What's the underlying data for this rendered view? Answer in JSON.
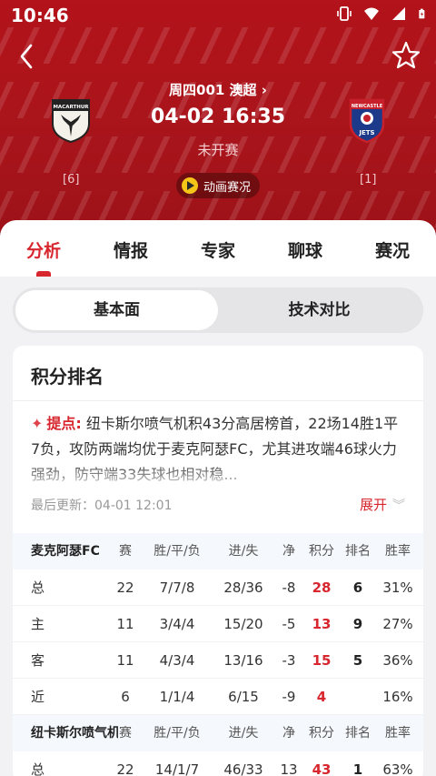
{
  "status_bar": {
    "time": "10:46"
  },
  "header": {
    "league": "周四001  澳超",
    "kickoff": "04-02 16:35",
    "match_status": "未开赛",
    "home": {
      "logo_text": "MACARTHUR",
      "rank": "[6]"
    },
    "away": {
      "logo_text": "NEWCASTLE",
      "logo_sub": "JETS",
      "rank": "[1]"
    },
    "animation_label": "动画赛况"
  },
  "tabs": [
    "分析",
    "情报",
    "专家",
    "聊球",
    "赛况"
  ],
  "segment": [
    "基本面",
    "技术对比"
  ],
  "standings": {
    "title": "积分排名",
    "tip_label": "提点:",
    "tip_text": "纽卡斯尔喷气机积43分高居榜首，22场14胜1平7负，攻防两端均优于麦克阿瑟FC，尤其进攻端46球火力强劲，防守端33失球也相对稳...",
    "updated": "最后更新：04-01 12:01",
    "expand": "展开",
    "columns": [
      "赛",
      "胜/平/负",
      "进/失",
      "净",
      "积分",
      "排名",
      "胜率"
    ],
    "teams": [
      {
        "name": "麦克阿瑟FC",
        "rows": [
          {
            "label": "总",
            "played": "22",
            "wdl": "7/7/8",
            "gf_ga": "28/36",
            "gd": "-8",
            "pts": "28",
            "rank": "6",
            "winrate": "31%"
          },
          {
            "label": "主",
            "played": "11",
            "wdl": "3/4/4",
            "gf_ga": "15/20",
            "gd": "-5",
            "pts": "13",
            "rank": "9",
            "winrate": "27%"
          },
          {
            "label": "客",
            "played": "11",
            "wdl": "4/3/4",
            "gf_ga": "13/16",
            "gd": "-3",
            "pts": "15",
            "rank": "5",
            "winrate": "36%"
          },
          {
            "label": "近",
            "played": "6",
            "wdl": "1/1/4",
            "gf_ga": "6/15",
            "gd": "-9",
            "pts": "4",
            "rank": "",
            "winrate": "16%"
          }
        ]
      },
      {
        "name": "纽卡斯尔喷气机",
        "rows": [
          {
            "label": "总",
            "played": "22",
            "wdl": "14/1/7",
            "gf_ga": "46/33",
            "gd": "13",
            "pts": "43",
            "rank": "1",
            "winrate": "63%"
          }
        ]
      }
    ]
  },
  "colors": {
    "brand_red": "#b3131a",
    "accent_red": "#d7262e"
  }
}
